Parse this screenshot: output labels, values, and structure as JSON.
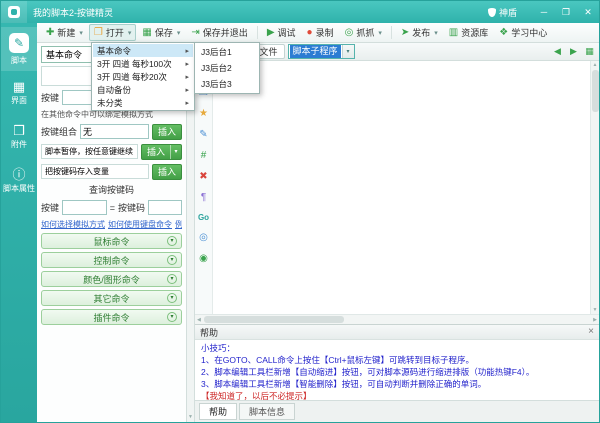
{
  "titlebar": {
    "title": "我的脚本2-按键精灵",
    "shield": "神盾",
    "minimize": "─",
    "maximize": "❐",
    "close": "✕"
  },
  "toolbar": {
    "new": "新建",
    "open": "打开",
    "save": "保存",
    "save_exit": "保存并退出",
    "debug": "调试",
    "record": "录制",
    "grab": "抓抓",
    "publish": "发布",
    "resource": "资源库",
    "learn": "学习中心"
  },
  "sidebar": {
    "script": "脚本",
    "ui": "界面",
    "attachment": "附件",
    "properties": "脚本属性"
  },
  "panel": {
    "category": "基本命令",
    "key_row_label": "按键",
    "insert": "插入",
    "note": "在其他命令中可以绑定模拟方式",
    "combo_label": "按键组合",
    "combo_value": "无",
    "pause_label": "脚本暂停，按任意键继续",
    "store_label": "把按键码存入变量",
    "query_title": "查询按键码",
    "query_key": "按键",
    "query_eq": "=",
    "query_code": "按键码",
    "link1": "如何选择模拟方式",
    "link2": "如何使用键盘命令",
    "link3": "例子",
    "group1": "鼠标命令",
    "group2": "控制命令",
    "group3": "颜色/图形命令",
    "group4": "其它命令",
    "group5": "插件命令"
  },
  "menu": {
    "item1": "基本命令",
    "item2": "3开 四道 每秒100次",
    "item3": "3开 四道 每秒20次",
    "item4": "自动备份",
    "item5": "未分类",
    "sub1": "J3后台1",
    "sub2": "J3后台2",
    "sub3": "J3后台3"
  },
  "editor": {
    "tab": "源文件",
    "combo": "脚本子程序"
  },
  "editor_icons": {
    "user": "☻",
    "copy": "❐",
    "star": "★",
    "pen": "✎",
    "indent": "#",
    "del": "✖",
    "comment": "¶",
    "goto": "Go",
    "find": "◎",
    "eye": "◉"
  },
  "help": {
    "title": "帮助",
    "tip_title": "小技巧：",
    "tip1": "1、在GOTO、CALL命令上按住【Ctrl+鼠标左键】可跳转到目标子程序。",
    "tip2": "2、脚本编辑工具栏新增【自动缩进】按钮，可对脚本源码进行缩进排版（功能热键F4）。",
    "tip3": "3、脚本编辑工具栏新增【智能删除】按钮，可自动判断并删除正确的单词。",
    "dismiss": "【我知道了，以后不必提示】"
  },
  "bottom_tabs": {
    "help": "帮助",
    "info": "脚本信息"
  },
  "icons": {
    "plus": "✚",
    "folder": "❐",
    "save": "▦",
    "save_exit": "⇥",
    "debug": "▶",
    "record": "●",
    "grab": "◎",
    "publish": "➤",
    "resource": "▥",
    "learn": "❖",
    "dropdown": "▾",
    "menu_arrow": "▸",
    "script": "✎",
    "ui": "▦",
    "attach": "❒",
    "props": "ⓘ",
    "doc": "▤",
    "nav_left": "◀",
    "nav_right": "▶",
    "grid": "▦",
    "close": "×",
    "up": "▲",
    "down": "▼",
    "left": "◀",
    "right": "▶",
    "expand": "▾"
  },
  "colors": {
    "titlebar_teal": "#33b9b2",
    "sidebar_teal": "#2fb0a9",
    "toolbar_green": "#3aa34d",
    "button_green": "#43a047",
    "selection_blue": "#2b7cd3",
    "tip_blue": "#2424cc",
    "tip_red": "#cc2424",
    "link_blue": "#3366cc"
  }
}
